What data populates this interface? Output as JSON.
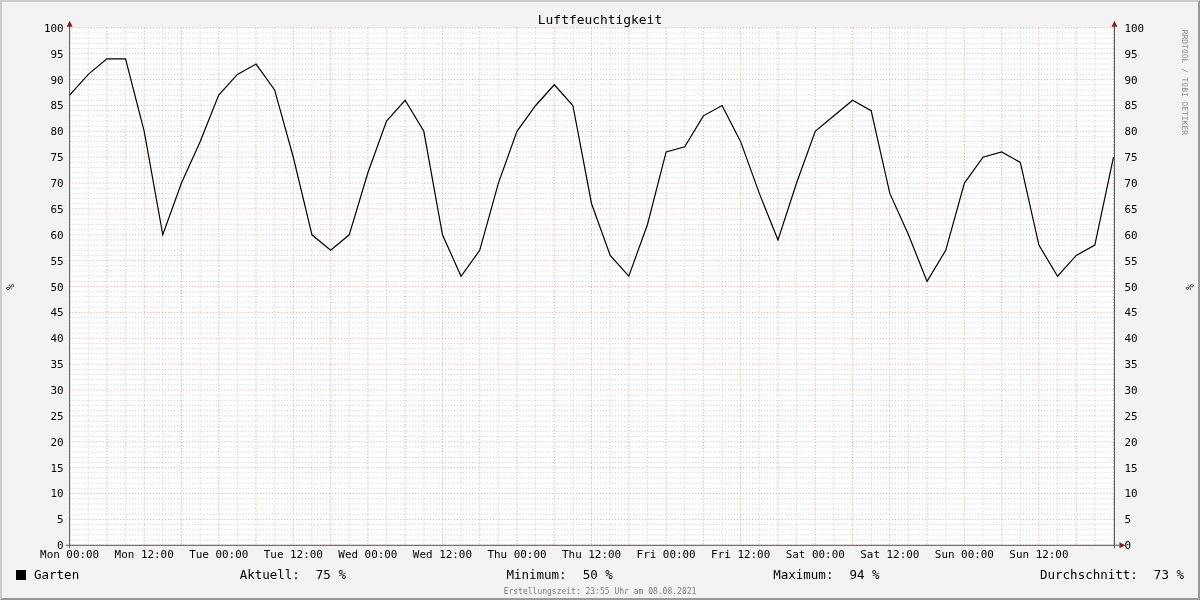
{
  "graph": {
    "credit": "RRDTOOL / TOBI OETIKER",
    "right_axis_label": "%",
    "right_axis_ticks": [
      "100",
      "95",
      "90",
      "85",
      "80",
      "75",
      "70",
      "65",
      "60",
      "55",
      "50",
      "45",
      "40",
      "35",
      "30",
      "25",
      "20",
      "15",
      "10",
      "5",
      "0"
    ],
    "chart_data": {
      "type": "line",
      "title": "Luftfeuchtigkeit",
      "ylabel": "%",
      "categories": [
        "Mon 00:00",
        null,
        null,
        null,
        "Mon 12:00",
        null,
        null,
        null,
        "Tue 00:00",
        null,
        null,
        null,
        "Tue 12:00",
        null,
        null,
        null,
        "Wed 00:00",
        null,
        null,
        null,
        "Wed 12:00",
        null,
        null,
        null,
        "Thu 00:00",
        null,
        null,
        null,
        "Thu 12:00",
        null,
        null,
        null,
        "Fri 00:00",
        null,
        null,
        null,
        "Fri 12:00",
        null,
        null,
        null,
        "Sat 00:00",
        null,
        null,
        null,
        "Sat 12:00",
        null,
        null,
        null,
        "Sun 00:00",
        null,
        null,
        null,
        "Sun 12:00",
        null,
        null,
        null,
        null
      ],
      "series": [
        {
          "name": "Garten",
          "color": "#000000",
          "values": [
            87,
            91,
            94,
            94,
            80,
            60,
            70,
            78,
            87,
            91,
            93,
            88,
            75,
            60,
            57,
            60,
            72,
            82,
            86,
            80,
            60,
            52,
            57,
            70,
            80,
            85,
            89,
            85,
            66,
            56,
            52,
            62,
            76,
            77,
            83,
            85,
            78,
            68,
            59,
            70,
            80,
            83,
            86,
            84,
            68,
            60,
            51,
            57,
            70,
            75,
            76,
            74,
            58,
            52,
            56,
            58,
            75
          ]
        }
      ],
      "ylim": [
        0,
        100
      ],
      "grid": true,
      "yticks": [
        0,
        5,
        10,
        15,
        20,
        25,
        30,
        35,
        40,
        45,
        50,
        55,
        60,
        65,
        70,
        75,
        80,
        85,
        90,
        95,
        100
      ]
    }
  },
  "legend": {
    "stats": [
      {
        "label": "Aktuell:",
        "value": "75 %"
      },
      {
        "label": "Minimum:",
        "value": "50 %"
      },
      {
        "label": "Maximum:",
        "value": "94 %"
      },
      {
        "label": "Durchschnitt:",
        "value": "73 %"
      }
    ]
  },
  "footer": "Erstellungszeit: 23:55 Uhr am 08.08.2021"
}
